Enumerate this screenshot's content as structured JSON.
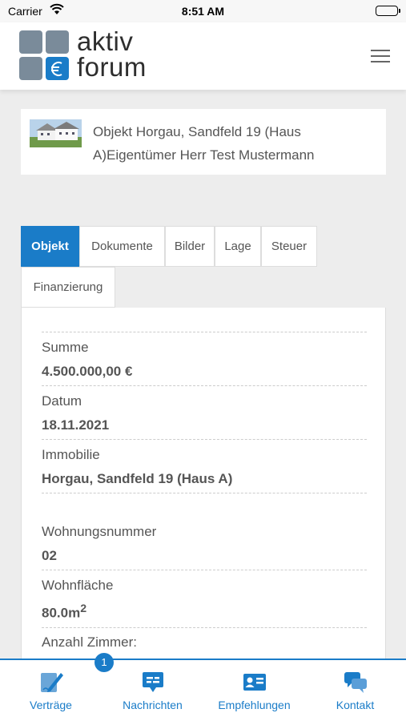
{
  "status_bar": {
    "carrier": "Carrier",
    "time": "8:51 AM"
  },
  "header": {
    "logo_line1": "aktiv",
    "logo_line2": "forum"
  },
  "object": {
    "title": "Objekt Horgau, Sandfeld 19 (Haus A)Eigentümer Herr Test Mustermann"
  },
  "tabs": [
    {
      "label": "Objekt",
      "active": true
    },
    {
      "label": "Dokumente",
      "active": false
    },
    {
      "label": "Bilder",
      "active": false
    },
    {
      "label": "Lage",
      "active": false
    },
    {
      "label": "Steuer",
      "active": false
    },
    {
      "label": "Finanzierung",
      "active": false
    }
  ],
  "fields": [
    {
      "label": "Summe",
      "value": "4.500.000,00 €"
    },
    {
      "label": "Datum",
      "value": "18.11.2021"
    },
    {
      "label": "Immobilie",
      "value": "Horgau, Sandfeld 19 (Haus A)"
    },
    {
      "label": "Wohnungsnummer",
      "value": "02"
    },
    {
      "label": "Wohnfläche",
      "value": "80.0m",
      "superscript": "2"
    },
    {
      "label": "Anzahl Zimmer:",
      "value": ""
    }
  ],
  "bottom_nav": {
    "items": [
      {
        "label": "Verträge",
        "icon": "contract-pen-icon"
      },
      {
        "label": "Nachrichten",
        "icon": "message-icon"
      },
      {
        "label": "Empfehlungen",
        "icon": "contact-card-icon"
      },
      {
        "label": "Kontakt",
        "icon": "chat-bubbles-icon"
      }
    ],
    "badge_count": "1"
  },
  "colors": {
    "accent": "#1a7cc8",
    "logo_gray": "#7a8b9a"
  }
}
